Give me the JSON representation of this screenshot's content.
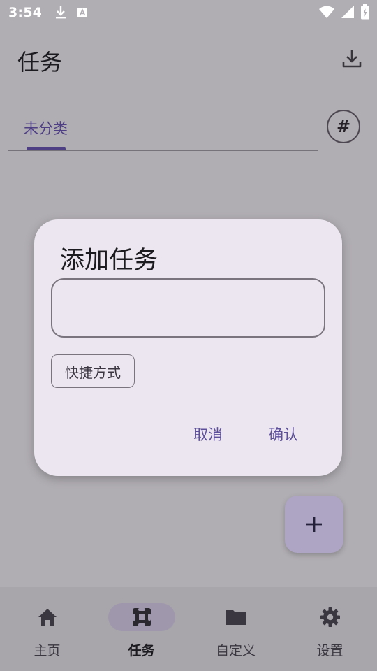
{
  "status_bar": {
    "time": "3:54",
    "icons": [
      "download-icon",
      "a-icon",
      "wifi-icon",
      "signal-icon",
      "battery-icon"
    ]
  },
  "app_bar": {
    "title": "任务",
    "action_icon": "download-icon"
  },
  "tabs": {
    "items": [
      {
        "label": "未分类",
        "selected": true
      }
    ],
    "hash_label": "#"
  },
  "dialog": {
    "title": "添加任务",
    "input_value": "",
    "input_placeholder": "",
    "chip_label": "快捷方式",
    "cancel_label": "取消",
    "confirm_label": "确认"
  },
  "fab": {
    "icon": "plus-icon"
  },
  "bottom_nav": {
    "items": [
      {
        "label": "主页",
        "icon": "home-icon",
        "active": false
      },
      {
        "label": "任务",
        "icon": "puzzle-icon",
        "active": true
      },
      {
        "label": "自定义",
        "icon": "folder-icon",
        "active": false
      },
      {
        "label": "设置",
        "icon": "gear-icon",
        "active": false
      }
    ]
  },
  "colors": {
    "scrim_background": "#b1aeb3",
    "accent": "#4e3f85",
    "dialog_surface": "#ece6f0",
    "fab": "#aea5c4",
    "nav_background": "#a8a5ab"
  }
}
